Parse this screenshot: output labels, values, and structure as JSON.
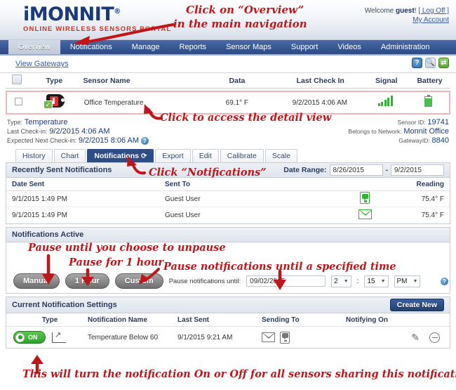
{
  "header": {
    "logo_main": "iMONNIT",
    "logo_reg": "®",
    "logo_sub": "ONLINE WIRELESS SENSORS PORTAL",
    "welcome_prefix": "Welcome ",
    "welcome_user": "guest",
    "welcome_suffix": "!",
    "log_off": "[ Log Off ]",
    "my_account": "My Account"
  },
  "nav": {
    "items": [
      {
        "label": "Overview",
        "active": true
      },
      {
        "label": "Notifications",
        "active": false
      },
      {
        "label": "Manage",
        "active": false
      },
      {
        "label": "Reports",
        "active": false
      },
      {
        "label": "Sensor Maps",
        "active": false
      },
      {
        "label": "Support",
        "active": false
      },
      {
        "label": "Videos",
        "active": false
      },
      {
        "label": "Administration",
        "active": false
      }
    ]
  },
  "subbar": {
    "view_gateways": "View Gateways",
    "icons": {
      "help": "?",
      "search": "search-icon",
      "refresh": "refresh-icon"
    }
  },
  "sensor_table": {
    "headers": [
      "",
      "Type",
      "Sensor Name",
      "Data",
      "Last Check In",
      "Signal",
      "Battery"
    ],
    "rows": [
      {
        "type_icon": "temperature-tag-icon",
        "name": "Office Temperature",
        "data": "69.1° F",
        "last_check_in": "9/2/2015 4:06 AM",
        "signal_bars": 5,
        "battery_percent": 75
      }
    ]
  },
  "detail_meta": {
    "type_label": "Type:",
    "type_value": "Temperature",
    "last_checkin_label": "Last Check-in:",
    "last_checkin_value": "9/2/2015 4:06 AM",
    "expected_label": "Expected Next Check-in:",
    "expected_value": "9/2/2015 8:06 AM",
    "sensor_id_label": "Sensor ID:",
    "sensor_id_value": "19741",
    "network_label": "Belongs to Network:",
    "network_value": "Monnit Office",
    "gateway_label": "GatewayID:",
    "gateway_value": "8840"
  },
  "tabs": [
    {
      "label": "History",
      "active": false
    },
    {
      "label": "Chart",
      "active": false
    },
    {
      "label": "Notifications",
      "active": true,
      "spinner": "⟳"
    },
    {
      "label": "Export",
      "active": false
    },
    {
      "label": "Edit",
      "active": false
    },
    {
      "label": "Calibrate",
      "active": false
    },
    {
      "label": "Scale",
      "active": false
    }
  ],
  "recently_sent": {
    "title": "Recently Sent Notifications",
    "date_range_label": "Date Range:",
    "date_from": "8/26/2015",
    "date_sep": "-",
    "date_to": "9/2/2015",
    "headers": [
      "Date Sent",
      "Sent To",
      "",
      "Reading"
    ],
    "rows": [
      {
        "date_sent": "9/1/2015 1:49 PM",
        "sent_to": "Guest User",
        "channel": "pager-icon",
        "reading": "75.4° F"
      },
      {
        "date_sent": "9/1/2015 1:49 PM",
        "sent_to": "Guest User",
        "channel": "envelope-icon",
        "reading": "75.4° F"
      }
    ]
  },
  "notifications_active": {
    "title": "Notifications Active",
    "buttons": {
      "manual": "Manual",
      "one_hour": "1 Hour",
      "custom": "Custom"
    },
    "pause_label": "Pause notifications until:",
    "pause_date": "09/02/2015",
    "hour": "2",
    "time_sep": ":",
    "minute": "15",
    "meridiem": "PM",
    "help": "?"
  },
  "current_settings": {
    "title": "Current Notification Settings",
    "create_new": "Create New",
    "headers": [
      "",
      "Type",
      "Notification Name",
      "Last Sent",
      "Sending To",
      "Notifying On",
      ""
    ],
    "rows": [
      {
        "toggle_state": "ON",
        "type_icon": "chart-line-icon",
        "name": "Temperature Below 60",
        "last_sent": "9/1/2015 9:21 AM",
        "sending_to": [
          "envelope-icon",
          "pager-icon"
        ],
        "notifying_on": "",
        "actions": [
          "edit-pencil-icon",
          "remove-minus-icon"
        ]
      }
    ]
  },
  "annotations": {
    "color": "#c0161a",
    "overview_line1": "Click on “Overview”",
    "overview_line2": "in the main navigation",
    "detail_view": "Click to access the detail view",
    "notifications_tab": "Click “Notifications”",
    "pause_manual": "Pause until you choose to unpause",
    "pause_hour": "Pause for 1 hour",
    "pause_custom": "Pause notifications until a specified time",
    "toggle_note": "This will turn the notification On or Off for all sensors sharing this notification"
  }
}
